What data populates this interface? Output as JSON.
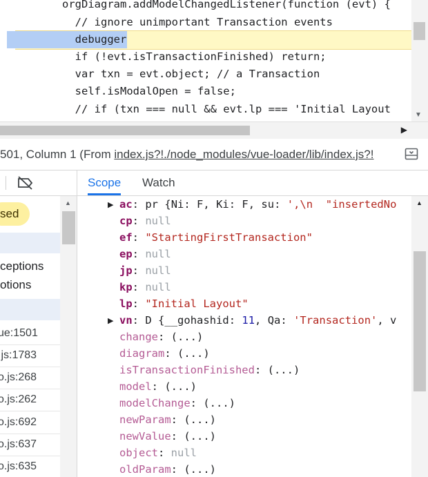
{
  "editor": {
    "lines": [
      "orgDiagram.addModelChangedListener(function (evt) {",
      "  // ignore unimportant Transaction events",
      "  debugger",
      "  if (!evt.isTransactionFinished) return;",
      "  var txn = evt.object; // a Transaction",
      "  self.isModalOpen = false;",
      "  // if (txn === null && evt.lp === 'Initial Layout"
    ]
  },
  "status_bar": {
    "position_text": "501, Column 1  (From ",
    "source_link": "index.js?!./node_modules/vue-loader/lib/index.js?!",
    "toggle_icon": "sidebar-toggle-icon"
  },
  "left_pane": {
    "breakpoint_icon": "deactivate-breakpoints-icon",
    "paused_label": "sed",
    "exceptions": [
      "ceptions",
      "otions"
    ],
    "call_frames": [
      "ue:1501",
      ".js:1783",
      "o.js:268",
      "o.js:262",
      "o.js:692",
      "o.js:637",
      "o.js:635"
    ]
  },
  "right_pane": {
    "tabs": [
      "Scope",
      "Watch"
    ],
    "scope": {
      "ac": {
        "key": "ac",
        "constructor": "pr",
        "preview_open": "{",
        "p1_key": "Ni",
        "p1_val": "F",
        "p2_key": "Ki",
        "p2_val": "F",
        "p3_key": "su",
        "p3_val": "',\\n  \"insertedNo"
      },
      "cp": {
        "key": "cp",
        "value": "null"
      },
      "ef": {
        "key": "ef",
        "value": "\"StartingFirstTransaction\""
      },
      "ep": {
        "key": "ep",
        "value": "null"
      },
      "jp": {
        "key": "jp",
        "value": "null"
      },
      "kp": {
        "key": "kp",
        "value": "null"
      },
      "lp": {
        "key": "lp",
        "value": "\"Initial Layout\""
      },
      "vn": {
        "key": "vn",
        "constructor": "D",
        "preview_open": "{",
        "p1_key": "__gohashid",
        "p1_val": "11",
        "p2_key": "Qa",
        "p2_val": "'Transaction'",
        "tail": ", v"
      },
      "accessors": [
        {
          "key": "change",
          "value": "(...)"
        },
        {
          "key": "diagram",
          "value": "(...)"
        },
        {
          "key": "isTransactionFinished",
          "value": "(...)"
        },
        {
          "key": "model",
          "value": "(...)"
        },
        {
          "key": "modelChange",
          "value": "(...)"
        },
        {
          "key": "newParam",
          "value": "(...)"
        },
        {
          "key": "newValue",
          "value": "(...)"
        },
        {
          "key": "object",
          "value": "null"
        },
        {
          "key": "oldParam",
          "value": "(...)"
        }
      ]
    }
  }
}
